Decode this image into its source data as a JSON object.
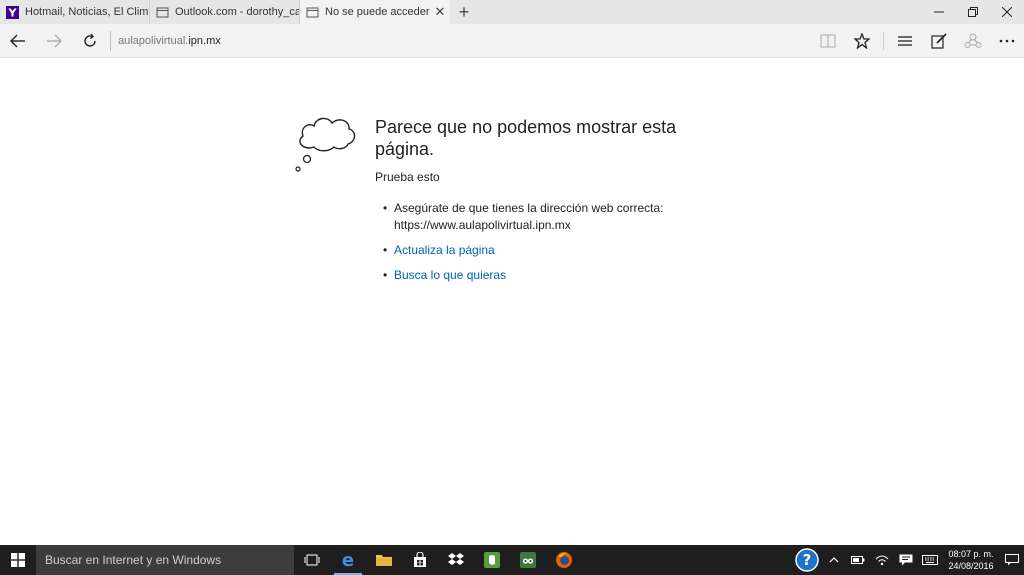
{
  "tabs": [
    {
      "title": "Hotmail, Noticias, El Clima,",
      "icon": "yahoo-favicon"
    },
    {
      "title": "Outlook.com - dorothy_canc",
      "icon": "page-favicon"
    },
    {
      "title": "No se puede acceder a l",
      "icon": "page-favicon"
    }
  ],
  "new_tab": "+",
  "address": {
    "prefix": "aulapolivirtual.",
    "host": "ipn.mx"
  },
  "error": {
    "heading": "Parece que no podemos mostrar esta página.",
    "try_label": "Prueba esto",
    "items": [
      {
        "line1": "Asegúrate de que tienes la dirección web correcta:",
        "line2": "https://www.aulapolivirtual.ipn.mx"
      },
      {
        "text": "Actualiza la página"
      },
      {
        "text": "Busca lo que quieras"
      }
    ]
  },
  "taskbar": {
    "search_placeholder": "Buscar en Internet y en Windows",
    "time": "08:07 p. m.",
    "date": "24/08/2016"
  },
  "colors": {
    "link": "#0063b1",
    "taskbar": "#1e1e1e",
    "tabbar": "#e6e6e6",
    "accent_edge": "#1e73c8"
  }
}
